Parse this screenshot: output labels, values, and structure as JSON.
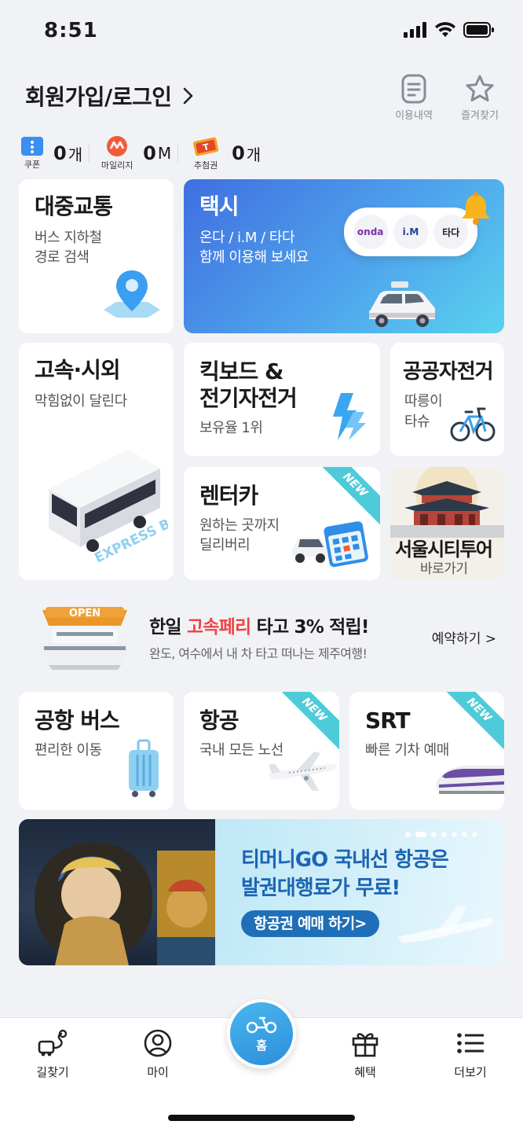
{
  "status_bar": {
    "time": "8:51"
  },
  "header": {
    "login_label": "회원가입/로그인",
    "actions": [
      {
        "label": "이용내역",
        "icon": "document-icon"
      },
      {
        "label": "즐겨찾기",
        "icon": "star-icon"
      }
    ]
  },
  "points": [
    {
      "label": "쿠폰",
      "value": "0",
      "unit": "개",
      "icon": "coupon-icon",
      "color": "#3a8ff0"
    },
    {
      "label": "마일리지",
      "value": "0",
      "unit": "M",
      "icon": "mileage-icon",
      "color": "#f25b38"
    },
    {
      "label": "추첨권",
      "value": "0",
      "unit": "개",
      "icon": "ticket-icon",
      "color": "#f6a420"
    }
  ],
  "cards": {
    "transit": {
      "title": "대중교통",
      "sub1": "버스 지하철",
      "sub2": "경로 검색"
    },
    "taxi": {
      "title": "택시",
      "sub1": "온다 / i.M / 타다",
      "sub2": "함께 이용해 보세요",
      "brands": [
        "onda",
        "i.M",
        "타다"
      ]
    },
    "express": {
      "title": "고속·시외",
      "sub": "막힘없이 달린다",
      "bus_text": "EXPRESS BUS"
    },
    "kickboard": {
      "title1": "킥보드 &",
      "title2": "전기자전거",
      "sub": "보유율 1위"
    },
    "bike": {
      "title": "공공자전거",
      "sub1": "따릉이",
      "sub2": "타슈"
    },
    "rentcar": {
      "title": "렌터카",
      "sub1": "원하는 곳까지",
      "sub2": "딜리버리",
      "badge": "NEW"
    },
    "citytour": {
      "title": "서울시티투어",
      "sub": "바로가기"
    },
    "airport_bus": {
      "title": "공항 버스",
      "sub": "편리한 이동"
    },
    "flight": {
      "title": "항공",
      "sub": "국내 모든 노선",
      "badge": "NEW"
    },
    "srt": {
      "title": "SRT",
      "sub": "빠른 기차 예매",
      "badge": "NEW"
    }
  },
  "promo": {
    "title_prefix": "한일 ",
    "title_accent": "고속페리",
    "title_suffix": " 타고 3% 적립!",
    "sub": "완도, 여수에서 내 차 타고 떠나는 제주여행!",
    "cta": "예약하기 >",
    "sign": "OPEN",
    "accent_color": "#f04444"
  },
  "banner": {
    "line1": "티머니GO 국내선 항공은",
    "line2": "발권대행료가 무료!",
    "button": "항공권 예매 하기>"
  },
  "tabbar": {
    "items": [
      {
        "label": "길찾기",
        "icon": "route-icon"
      },
      {
        "label": "마이",
        "icon": "profile-icon"
      },
      {
        "label": "홈",
        "icon": "home-icon"
      },
      {
        "label": "혜택",
        "icon": "gift-icon"
      },
      {
        "label": "더보기",
        "icon": "menu-icon"
      }
    ]
  }
}
